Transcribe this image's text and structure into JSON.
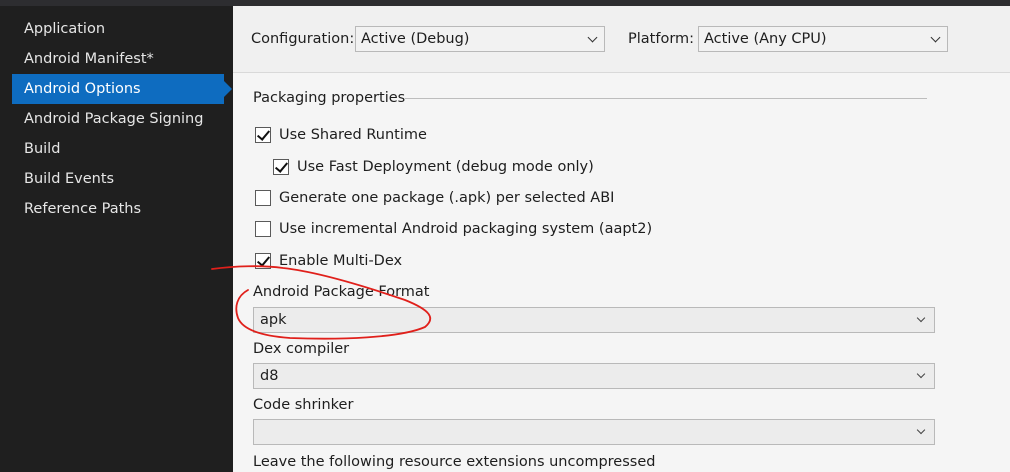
{
  "sidebar": {
    "items": [
      {
        "label": "Application"
      },
      {
        "label": "Android Manifest*"
      },
      {
        "label": "Android Options"
      },
      {
        "label": "Android Package Signing"
      },
      {
        "label": "Build"
      },
      {
        "label": "Build Events"
      },
      {
        "label": "Reference Paths"
      }
    ],
    "active_index": 2
  },
  "toolbar": {
    "configuration_label": "Configuration:",
    "configuration_value": "Active (Debug)",
    "platform_label": "Platform:",
    "platform_value": "Active (Any CPU)"
  },
  "packaging": {
    "section_title": "Packaging properties",
    "options": [
      {
        "label": "Use Shared Runtime",
        "checked": true
      },
      {
        "label": "Use Fast Deployment (debug mode only)",
        "checked": true
      },
      {
        "label": "Generate one package (.apk) per selected ABI",
        "checked": false
      },
      {
        "label": "Use incremental Android packaging system (aapt2)",
        "checked": false
      },
      {
        "label": "Enable Multi-Dex",
        "checked": true
      }
    ],
    "package_format_label": "Android Package Format",
    "package_format_value": "apk",
    "dex_compiler_label": "Dex compiler",
    "dex_compiler_value": "d8",
    "code_shrinker_label": "Code shrinker",
    "code_shrinker_value": "",
    "uncompressed_label": "Leave the following resource extensions uncompressed"
  },
  "colors": {
    "accent": "#0e6cc0",
    "sidebar_bg": "#1f1f1f",
    "annotation": "#e0201b"
  }
}
